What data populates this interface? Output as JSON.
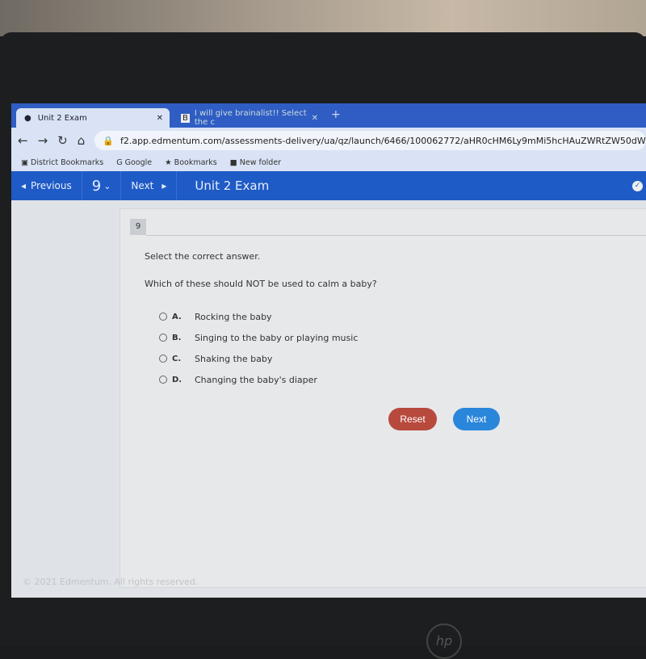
{
  "browser": {
    "tabs": [
      {
        "label": "Unit 2 Exam",
        "active": true
      },
      {
        "label": "I will give brainalist!! Select the c",
        "active": false
      }
    ],
    "url": "f2.app.edmentum.com/assessments-delivery/ua/qz/launch/6466/100062772/aHR0cHM6Ly9mMi5hcHAuZWRtZW50dW0uY29tL2",
    "bookmarks": [
      "District Bookmarks",
      "Google",
      "Bookmarks",
      "New folder"
    ]
  },
  "nav": {
    "previous": "Previous",
    "question_selector": "9",
    "next": "Next",
    "title": "Unit 2 Exam"
  },
  "question": {
    "number": "9",
    "instruction": "Select the correct answer.",
    "text": "Which of these should NOT be used to calm a baby?",
    "options": [
      {
        "letter": "A.",
        "text": "Rocking the baby"
      },
      {
        "letter": "B.",
        "text": "Singing to the baby or playing music"
      },
      {
        "letter": "C.",
        "text": "Shaking the baby"
      },
      {
        "letter": "D.",
        "text": "Changing the baby's diaper"
      }
    ],
    "reset_label": "Reset",
    "next_label": "Next"
  },
  "footer": "© 2021 Edmentum. All rights reserved.",
  "colors": {
    "nav": "#1f5bc6",
    "reset": "#b8493d",
    "next": "#2a86da"
  }
}
